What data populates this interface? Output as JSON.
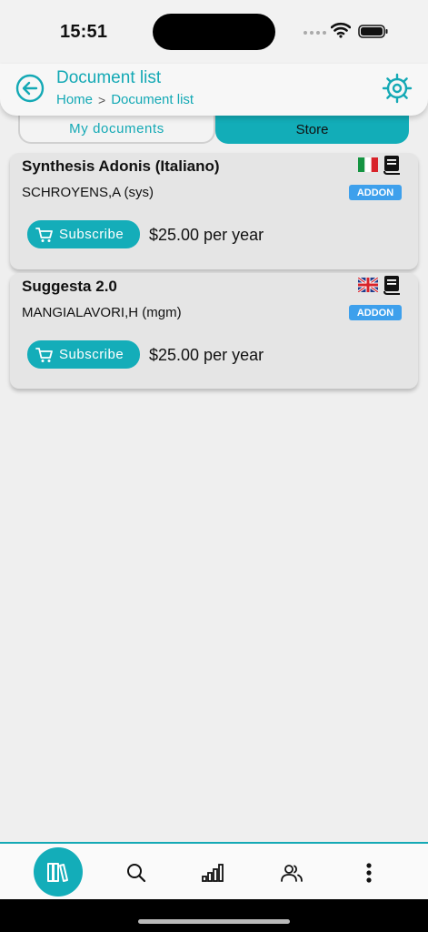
{
  "status_bar": {
    "time": "15:51"
  },
  "header": {
    "title": "Document list",
    "breadcrumb": {
      "home": "Home",
      "separator": ">",
      "current": "Document list"
    }
  },
  "tabs": [
    {
      "label": "My documents",
      "active": false
    },
    {
      "label": "Store",
      "active": true
    }
  ],
  "documents": [
    {
      "title": "Synthesis Adonis (Italiano)",
      "author": "SCHROYENS,A (sys)",
      "badge": "ADDON",
      "flag": "italy-flag-icon",
      "subscribe_label": "Subscribe",
      "price": "$25.00 per year"
    },
    {
      "title": "Suggesta 2.0",
      "author": "MANGIALAVORI,H (mgm)",
      "badge": "ADDON",
      "flag": "uk-flag-icon",
      "subscribe_label": "Subscribe",
      "price": "$25.00 per year"
    }
  ],
  "bottom_nav": [
    {
      "icon": "library-icon",
      "active": true
    },
    {
      "icon": "search-icon",
      "active": false
    },
    {
      "icon": "signal-stats-icon",
      "active": false
    },
    {
      "icon": "users-icon",
      "active": false
    },
    {
      "icon": "more-vertical-icon",
      "active": false
    }
  ],
  "colors": {
    "accent": "#14a9b5",
    "badge": "#3ea0ec",
    "card": "#e5e5e5",
    "background": "#efefef"
  }
}
